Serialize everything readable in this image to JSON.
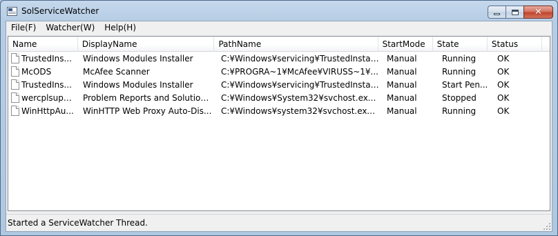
{
  "window": {
    "title": "SolServiceWatcher"
  },
  "menu": [
    {
      "label": "File(F)"
    },
    {
      "label": "Watcher(W)"
    },
    {
      "label": "Help(H)"
    }
  ],
  "table": {
    "columns": [
      "Name",
      "DisplayName",
      "PathName",
      "StartMode",
      "State",
      "Status"
    ],
    "rows": [
      [
        "TrustedIns...",
        "Windows Modules Installer",
        "C:¥Windows¥servicing¥TrustedInstal...",
        "Manual",
        "Running",
        "OK"
      ],
      [
        "McODS",
        "McAfee Scanner",
        "C:¥PROGRA~1¥McAfee¥VIRUSS~1¥...",
        "Manual",
        "Running",
        "OK"
      ],
      [
        "TrustedIns...",
        "Windows Modules Installer",
        "C:¥Windows¥servicing¥TrustedInstal...",
        "Manual",
        "Start Pen...",
        "OK"
      ],
      [
        "wercplsupp...",
        "Problem Reports and Solution...",
        "C:¥Windows¥System32¥svchost.exe...",
        "Manual",
        "Stopped",
        "OK"
      ],
      [
        "WinHttpAu...",
        "WinHTTP Web Proxy Auto-Dis...",
        "C:¥Windows¥system32¥svchost.exe ...",
        "Manual",
        "Running",
        "OK"
      ]
    ]
  },
  "statusbar": {
    "text": "Started a ServiceWatcher Thread."
  },
  "icons": {
    "app": "app-window-icon",
    "row": "document-icon",
    "minimize": "minimize-icon",
    "maximize": "maximize-icon",
    "close": "close-icon"
  }
}
